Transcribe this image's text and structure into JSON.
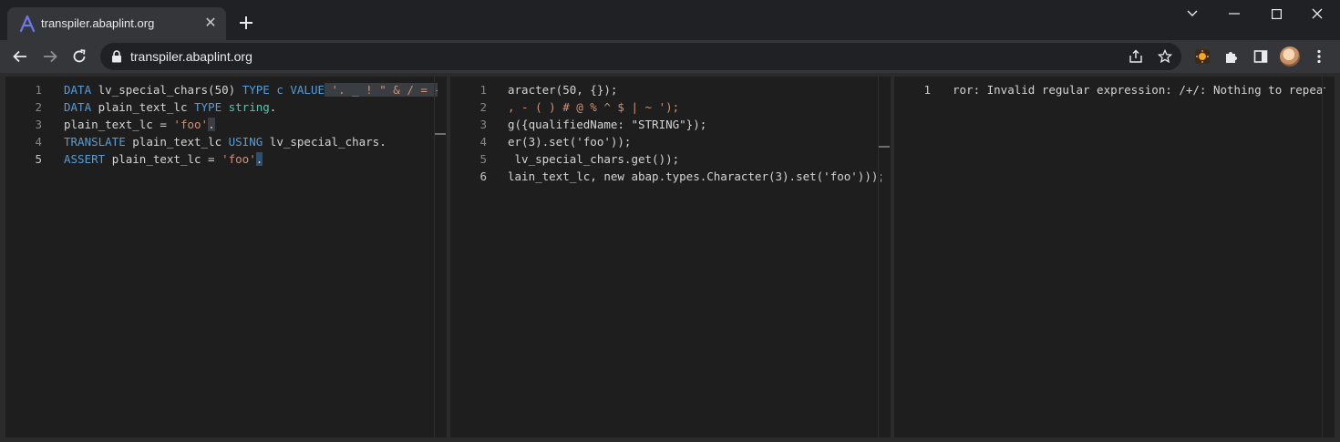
{
  "browser": {
    "tab_title": "transpiler.abaplint.org",
    "url": "transpiler.abaplint.org",
    "tab_close_glyph": "✕"
  },
  "editor1": {
    "lines": [
      {
        "n": "1",
        "segs": [
          [
            "kw",
            "DATA"
          ],
          [
            "",
            "lv_special_chars(50) "
          ],
          [
            "kw",
            "TYPE"
          ],
          [
            "",
            ""
          ],
          [
            "kw",
            " c"
          ],
          [
            "",
            ""
          ],
          [
            "kw",
            " VALUE"
          ],
          [
            "",
            ""
          ],
          [
            "str",
            " '. _ ! \" & / = -"
          ]
        ]
      },
      {
        "n": "2",
        "segs": [
          [
            "kw",
            "DATA"
          ],
          [
            "",
            "plain_text_lc "
          ],
          [
            "kw",
            "TYPE"
          ],
          [
            "",
            ""
          ],
          [
            "kw",
            " string"
          ],
          [
            "",
            "."
          ]
        ]
      },
      {
        "n": "3",
        "segs": [
          [
            "",
            "plain_text_lc = "
          ],
          [
            "str",
            "'foo'"
          ],
          [
            "",
            "."
          ]
        ]
      },
      {
        "n": "4",
        "segs": [
          [
            "kw",
            "TRANSLATE"
          ],
          [
            "",
            "plain_text_lc "
          ],
          [
            "kw",
            "USING"
          ],
          [
            "",
            "lv_special_chars."
          ]
        ]
      },
      {
        "n": "5",
        "segs": [
          [
            "kw",
            "ASSERT"
          ],
          [
            "",
            "plain_text_lc = "
          ],
          [
            "str",
            "'foo'"
          ],
          [
            "",
            "."
          ]
        ]
      }
    ]
  },
  "editor2": {
    "lines": [
      {
        "n": "1",
        "text": "aracter(50, {});"
      },
      {
        "n": "2",
        "text": ", - ( ) # @ % ^ $ | ~ ');"
      },
      {
        "n": "3",
        "text": "g({qualifiedName: \"STRING\"});"
      },
      {
        "n": "4",
        "text": "er(3).set('foo'));"
      },
      {
        "n": "5",
        "text": " lv_special_chars.get());"
      },
      {
        "n": "6",
        "text": "lain_text_lc, new abap.types.Character(3).set('foo')));"
      }
    ]
  },
  "editor3": {
    "lines": [
      {
        "n": "1",
        "text": "ror: Invalid regular expression: /+/: Nothing to repeat"
      }
    ]
  }
}
